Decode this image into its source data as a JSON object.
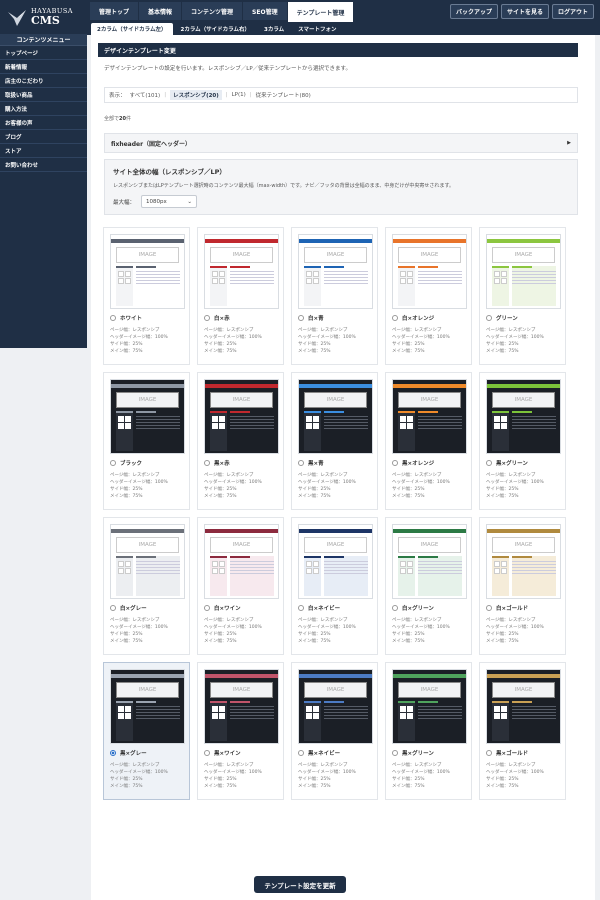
{
  "app": {
    "logo_line1": "HAYABUSA",
    "logo_line2": "CMS"
  },
  "main_nav": [
    "管理トップ",
    "基本情報",
    "コンテンツ管理",
    "SEO管理",
    "テンプレート管理"
  ],
  "main_nav_active": 4,
  "right_nav": [
    "バックアップ",
    "サイトを見る",
    "ログアウト"
  ],
  "sub_nav": [
    "2カラム（サイドカラム左）",
    "2カラム（サイドカラム右）",
    "3カラム",
    "スマートフォン"
  ],
  "sidebar": {
    "heading": "コンテンツメニュー",
    "items": [
      "トップページ",
      "新着情報",
      "店主のこだわり",
      "取扱い商品",
      "購入方法",
      "お客様の声",
      "ブログ",
      "ストア",
      "お問い合わせ"
    ]
  },
  "page": {
    "title": "デザインテンプレート変更",
    "description": "デザインテンプレートの設定を行います。レスポンシブ／LP／従来テンプレートから選択できます。",
    "filter": {
      "label": "表示：",
      "options": [
        "すべて(101)",
        "レスポンシブ(20)",
        "LP(1)",
        "従来テンプレート(80)"
      ],
      "selected": 1
    },
    "count_prefix": "全部で",
    "count_value": "20",
    "count_suffix": "件",
    "accordion_title": "fixheader（固定ヘッダー）",
    "width_section": {
      "title": "サイト全体の幅（レスポンシブ／LP）",
      "description": "レスポンシブまたはLPテンプレート選択時のコンテンツ最大幅（max-width）です。ナビ／フッタの背景は全幅のまま、中身だけが中央寄せされます。",
      "label": "最大幅：",
      "value": "1080px"
    },
    "submit_label": "テンプレート設定を更新"
  },
  "template_meta": {
    "page_width": "ページ幅：レスポンシブ",
    "header_width": "ヘッダーイメージ幅：100%",
    "side_width": "サイド幅：25%",
    "main_width": "メイン幅：75%",
    "image_label": "IMAGE"
  },
  "templates": [
    {
      "name": "ホワイト",
      "theme": "light",
      "accent": "#5a6270",
      "tint": "#f3f4f6",
      "selected": false
    },
    {
      "name": "白×赤",
      "theme": "light",
      "accent": "#c0282e",
      "tint": "#f3f4f6",
      "selected": false
    },
    {
      "name": "白×青",
      "theme": "light",
      "accent": "#1e64b4",
      "tint": "#f3f4f6",
      "selected": false
    },
    {
      "name": "白×オレンジ",
      "theme": "light",
      "accent": "#e8742a",
      "tint": "#f3f4f6",
      "selected": false
    },
    {
      "name": "グリーン",
      "theme": "light",
      "accent": "#8cc63f",
      "tint": "#eef5e4",
      "selected": false
    },
    {
      "name": "ブラック",
      "theme": "dark",
      "accent": "#8e97a4",
      "tint": "#1b1f26",
      "selected": false
    },
    {
      "name": "黒×赤",
      "theme": "dark",
      "accent": "#c0282e",
      "tint": "#1b1f26",
      "selected": false
    },
    {
      "name": "黒×青",
      "theme": "dark",
      "accent": "#3b8ee0",
      "tint": "#1b1f26",
      "selected": false
    },
    {
      "name": "黒×オレンジ",
      "theme": "dark",
      "accent": "#ef8a2a",
      "tint": "#1b1f26",
      "selected": false
    },
    {
      "name": "黒×グリーン",
      "theme": "dark",
      "accent": "#7cc33a",
      "tint": "#1b1f26",
      "selected": false
    },
    {
      "name": "白×グレー",
      "theme": "light",
      "accent": "#6b7079",
      "tint": "#eceef1",
      "selected": false
    },
    {
      "name": "白×ワイン",
      "theme": "light",
      "accent": "#8c2a3e",
      "tint": "#f7e9ee",
      "selected": false
    },
    {
      "name": "白×ネイビー",
      "theme": "light",
      "accent": "#1d3566",
      "tint": "#e7edf6",
      "selected": false
    },
    {
      "name": "白×グリーン",
      "theme": "light",
      "accent": "#2c7a45",
      "tint": "#e6f2ea",
      "selected": false
    },
    {
      "name": "白×ゴールド",
      "theme": "light",
      "accent": "#b08a3e",
      "tint": "#f5ecd9",
      "selected": false
    },
    {
      "name": "黒×グレー",
      "theme": "dark",
      "accent": "#9aa3b0",
      "tint": "#1b1f26",
      "selected": true
    },
    {
      "name": "黒×ワイン",
      "theme": "dark",
      "accent": "#c0546a",
      "tint": "#2a1a20",
      "selected": false
    },
    {
      "name": "黒×ネイビー",
      "theme": "dark",
      "accent": "#4c7bc4",
      "tint": "#18202e",
      "selected": false
    },
    {
      "name": "黒×グリーン",
      "theme": "dark",
      "accent": "#4fa35d",
      "tint": "#18231c",
      "selected": false
    },
    {
      "name": "黒×ゴールド",
      "theme": "dark",
      "accent": "#c9a054",
      "tint": "#24201a",
      "selected": false
    }
  ]
}
